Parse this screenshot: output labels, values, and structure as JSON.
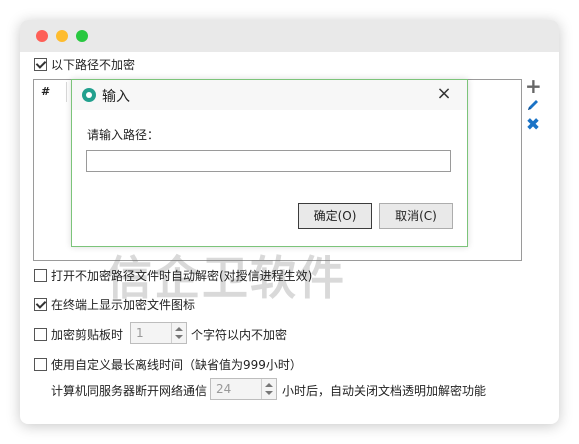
{
  "options": {
    "no_encrypt_paths_label": "以下路径不加密",
    "no_encrypt_paths_checked": true,
    "auto_decrypt_label": "打开不加密路径文件时自动解密(对授信进程生效)",
    "auto_decrypt_checked": false,
    "show_icon_label": "在终端上显示加密文件图标",
    "show_icon_checked": true,
    "clipboard_label": "加密剪贴板时",
    "clipboard_checked": false,
    "clipboard_value": "1",
    "clipboard_suffix": "个字符以内不加密",
    "offline_label": "使用自定义最长离线时间（缺省值为999小时）",
    "offline_checked": false,
    "offline_prefix": "计算机同服务器断开网络通信",
    "offline_value": "24",
    "offline_suffix": "小时后，自动关闭文档透明加解密功能"
  },
  "table": {
    "column_header": "#"
  },
  "side_icons": [
    "plus-icon",
    "pencil-icon",
    "delete-x-icon"
  ],
  "dialog": {
    "title": "输入",
    "close_glyph": "×",
    "prompt": "请输入路径：",
    "input_value": "",
    "ok_label": "确定(O)",
    "cancel_label": "取消(C)"
  },
  "watermark": "信企卫软件",
  "colors": {
    "accent_blue": "#1a73c6",
    "dialog_border": "#7cc47a",
    "dialog_icon": "#22a08e"
  }
}
